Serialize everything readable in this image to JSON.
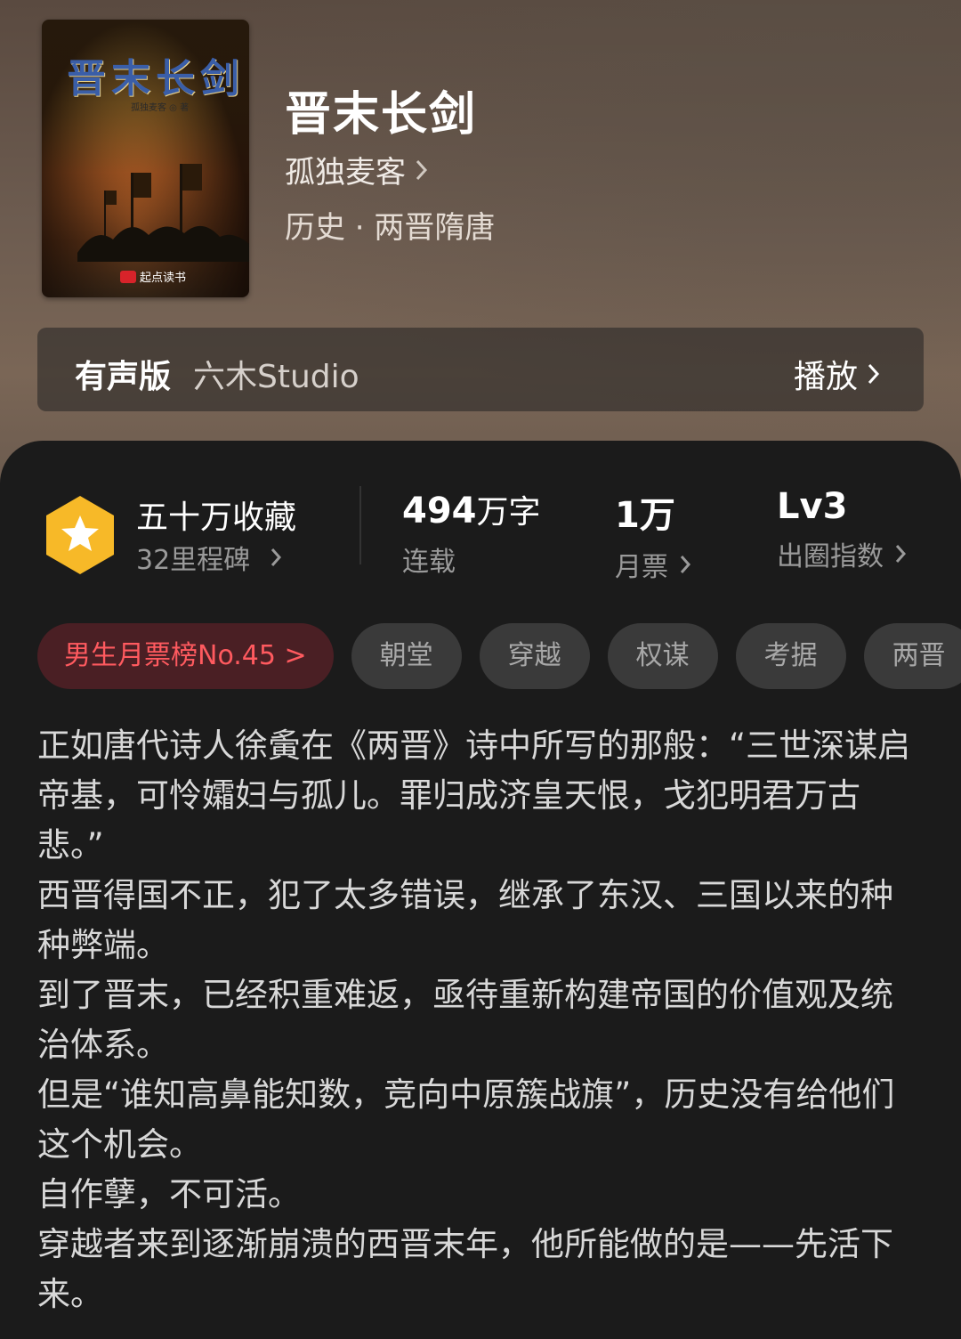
{
  "book": {
    "title": "晋末长剑",
    "author": "孤独麦客",
    "genre": "历史 · 两晋隋唐",
    "cover": {
      "title": "晋末长剑",
      "author_line": "孤独麦客 ◎ 著",
      "publisher_logo": "起点读书"
    }
  },
  "audio": {
    "label": "有声版",
    "studio": "六木Studio",
    "play_label": "播放"
  },
  "stats": {
    "collect": "五十万收藏",
    "milestone": "32里程碑",
    "words_num": "494",
    "words_unit": "万字",
    "status": "连载",
    "tickets_num": "1万",
    "tickets_label": "月票",
    "level": "Lv3",
    "level_label": "出圈指数"
  },
  "tags": [
    "男生月票榜No.45 >",
    "朝堂",
    "穿越",
    "权谋",
    "考据",
    "两晋"
  ],
  "description": [
    "正如唐代诗人徐夤在《两晋》诗中所写的那般：“三世深谋启帝基，可怜孀妇与孤儿。罪归成济皇天恨，戈犯明君万古悲。”",
    "西晋得国不正，犯了太多错误，继承了东汉、三国以来的种种弊端。",
    "到了晋末，已经积重难返，亟待重新构建帝国的价值观及统治体系。",
    "但是“谁知高鼻能知数，竞向中原簇战旗”，历史没有给他们这个机会。",
    "自作孽，不可活。",
    "穿越者来到逐渐崩溃的西晋末年，他所能做的是——先活下来。"
  ],
  "colors": {
    "accent_red": "#ff5a5f",
    "badge_yellow": "#f7b928",
    "panel_bg": "#1b1b1b"
  },
  "icons": {
    "badge": "star-hexagon-icon",
    "chevron": "chevron-right-icon"
  }
}
